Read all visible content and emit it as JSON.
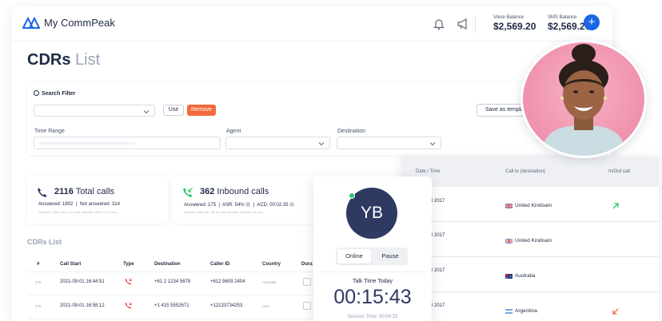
{
  "brand": {
    "name": "My CommPeak",
    "accent": "#1b66e8"
  },
  "header": {
    "voice_balance_label": "Voice Balance",
    "voice_balance_value": "$2,569.20",
    "sms_balance_label": "SMS Balance",
    "sms_balance_value": "$2,569.20",
    "plus_label": "+"
  },
  "page": {
    "title_bold": "CDRs",
    "title_light": "List"
  },
  "filters": {
    "search_filter_label": "Search Filter",
    "use_label": "Use",
    "remove_label": "Remove",
    "save_template_label": "Save as template",
    "time_range_label": "Time Range",
    "agent_label": "Agent",
    "destination_label": "Destination"
  },
  "stats": {
    "total": {
      "count": "2116",
      "label": "Total calls",
      "answered": "Answered: 1802",
      "not_answered": "Not answered: 314",
      "footnote": "Duration: 3501 min, 2 sec (58 duration: 3501 min 2 sec)"
    },
    "inbound": {
      "count": "362",
      "label": "Inbound calls",
      "answered": "Answered: 175",
      "asr": "ASR: 54%",
      "acd": "ACD: 00:02:35",
      "footnote": "Duration: 668 min, 36 sec (58 duration: 668 min 36 sec)"
    }
  },
  "cdrs": {
    "title": "CDRs List",
    "columns": [
      "#",
      "Call Start",
      "Type",
      "Destination",
      "Caller ID",
      "Country",
      "Dura"
    ],
    "rows": [
      {
        "num": "375",
        "start": "2021-09-01 16:44:51",
        "dest": "+61 2 1234 5678",
        "caller": "+612 9609 2404",
        "country": "Australia"
      },
      {
        "num": "376",
        "start": "2021-09-01 16:58:12",
        "dest": "+1 415 5552671",
        "caller": "+12133734253",
        "country": "USA"
      }
    ]
  },
  "right_table": {
    "columns": [
      "Date / Time",
      "Call to (desination)",
      "In/Out call"
    ],
    "rows": [
      {
        "date": "l 2017",
        "country": "United Kindoam",
        "dir": "out"
      },
      {
        "date": "l 2017",
        "country": "United Kindoam",
        "dir": ""
      },
      {
        "date": "l 2017",
        "country": "Australia",
        "dir": ""
      },
      {
        "date": "l 2017",
        "country": "Argentina",
        "dir": "in"
      }
    ]
  },
  "call_widget": {
    "initials": "YB",
    "online_label": "Online",
    "pause_label": "Pause",
    "talk_label": "Talk Time Today",
    "talk_time": "00:15:43",
    "session_time": "Session Time: 00:54:23"
  }
}
